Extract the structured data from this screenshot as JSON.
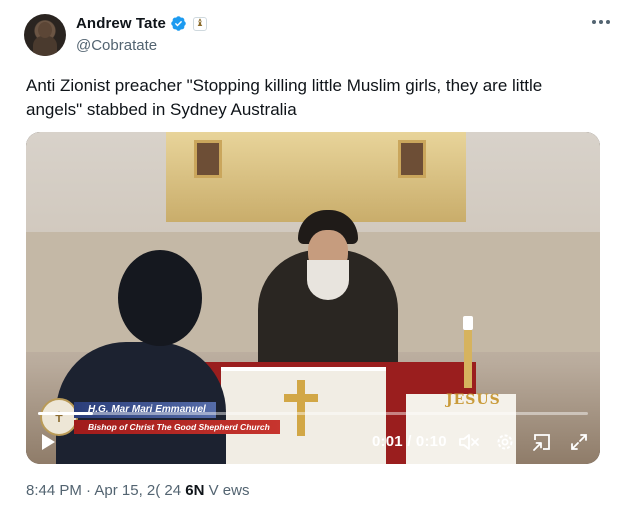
{
  "author": {
    "display_name": "Andrew Tate",
    "handle": "@Cobratate",
    "verified_icon": "verified-badge-icon",
    "affiliation_icon": "affiliate-badge-icon",
    "affiliation_glyph": "♝"
  },
  "tweet": {
    "text": "Anti Zionist preacher \"Stopping killing little Muslim girls, they are little angels\" stabbed in Sydney Australia"
  },
  "video": {
    "lower_third": {
      "name": "H.G. Mar Mari Emmanuel",
      "title": "Bishop of Christ The Good Shepherd Church"
    },
    "scene_text": "JESUS",
    "time_readout": "0:01 / 0:10",
    "progress": 0.1,
    "controls": [
      "play-icon",
      "mute-icon",
      "settings-icon",
      "pip-icon",
      "fullscreen-icon"
    ]
  },
  "meta": {
    "time": "8:44 PM",
    "sep1": " · ",
    "date": "Apr 15, 2( 24",
    "sep2": "  ",
    "views_count": "6N",
    "views_label": " V ews"
  },
  "colors": {
    "verified": "#1d9bf0",
    "secondary_text": "#536471",
    "primary_text": "#0f1419"
  }
}
